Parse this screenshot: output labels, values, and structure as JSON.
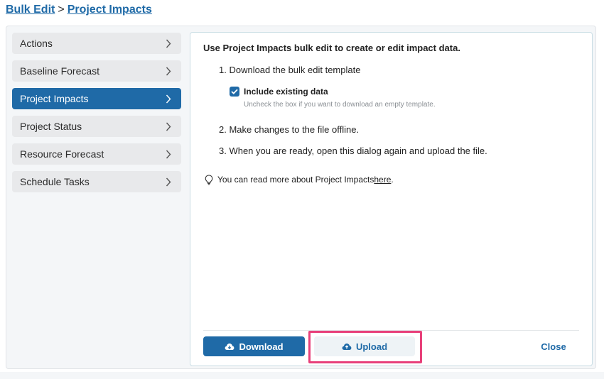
{
  "breadcrumb": {
    "root": "Bulk Edit",
    "separator": ">",
    "current": "Project Impacts"
  },
  "sidebar": {
    "items": [
      {
        "label": "Actions",
        "active": false
      },
      {
        "label": "Baseline Forecast",
        "active": false
      },
      {
        "label": "Project Impacts",
        "active": true
      },
      {
        "label": "Project Status",
        "active": false
      },
      {
        "label": "Resource Forecast",
        "active": false
      },
      {
        "label": "Schedule Tasks",
        "active": false
      }
    ]
  },
  "content": {
    "intro": "Use Project Impacts bulk edit to create or edit impact data.",
    "step1": "1. Download the bulk edit template",
    "checkbox": {
      "label": "Include existing data",
      "checked": true,
      "hint": "Uncheck the box if you want to download an empty template."
    },
    "step2": "2. Make changes to the file offline.",
    "step3": "3. When you are ready, open this dialog again and upload the file.",
    "info": {
      "prefix": "You can read more about Project Impacts ",
      "link": "here",
      "suffix": "."
    }
  },
  "footer": {
    "download_label": "Download",
    "upload_label": "Upload",
    "close_label": "Close"
  },
  "colors": {
    "accent": "#1f6aa7",
    "highlight": "#e8407a"
  },
  "icons": {
    "chevron": "chevron-right-icon",
    "checkbox": "check-icon",
    "info": "lightbulb-icon",
    "download": "cloud-download-icon",
    "upload": "cloud-upload-icon"
  }
}
